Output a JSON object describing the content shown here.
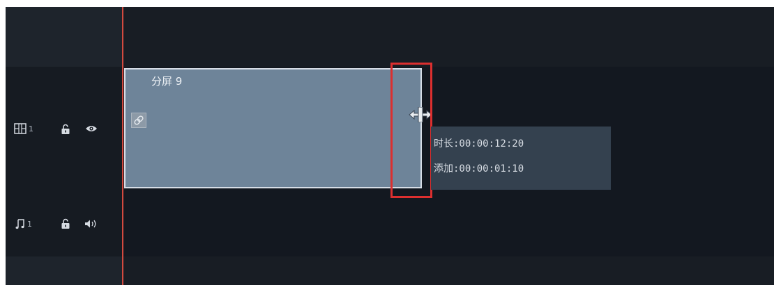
{
  "video_track": {
    "icon": "split-screen-track-icon",
    "number": "1",
    "lock_icon": "lock-icon",
    "visibility_icon": "eye-icon"
  },
  "audio_track": {
    "icon": "music-note-icon",
    "number": "1",
    "lock_icon": "lock-icon",
    "volume_icon": "speaker-icon"
  },
  "clip": {
    "title": "分屏 9",
    "link_icon": "link-icon"
  },
  "tooltip": {
    "duration": "时长:00:00:12:20",
    "added": "添加:00:00:01:10"
  },
  "colors": {
    "playhead": "#d24a3f",
    "clip_fill": "#6e8499",
    "highlight": "#dc2f2f",
    "tooltip_bg": "#34414f"
  }
}
